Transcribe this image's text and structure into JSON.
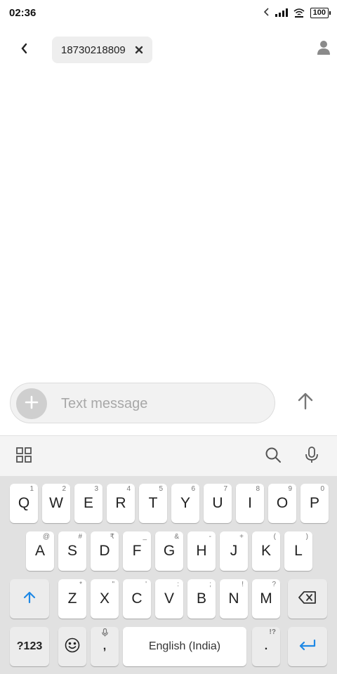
{
  "status_bar": {
    "time": "02:36",
    "battery": "100"
  },
  "header": {
    "recipient": "18730218809"
  },
  "compose": {
    "placeholder": "Text message"
  },
  "keyboard": {
    "row1": [
      {
        "label": "Q",
        "hint": "1"
      },
      {
        "label": "W",
        "hint": "2"
      },
      {
        "label": "E",
        "hint": "3"
      },
      {
        "label": "R",
        "hint": "4"
      },
      {
        "label": "T",
        "hint": "5"
      },
      {
        "label": "Y",
        "hint": "6"
      },
      {
        "label": "U",
        "hint": "7"
      },
      {
        "label": "I",
        "hint": "8"
      },
      {
        "label": "O",
        "hint": "9"
      },
      {
        "label": "P",
        "hint": "0"
      }
    ],
    "row2": [
      {
        "label": "A",
        "hint": "@"
      },
      {
        "label": "S",
        "hint": "#"
      },
      {
        "label": "D",
        "hint": "₹"
      },
      {
        "label": "F",
        "hint": "_"
      },
      {
        "label": "G",
        "hint": "&"
      },
      {
        "label": "H",
        "hint": "-"
      },
      {
        "label": "J",
        "hint": "+"
      },
      {
        "label": "K",
        "hint": "("
      },
      {
        "label": "L",
        "hint": ")"
      }
    ],
    "row3": [
      {
        "label": "Z",
        "hint": "*"
      },
      {
        "label": "X",
        "hint": "\""
      },
      {
        "label": "C",
        "hint": "'"
      },
      {
        "label": "V",
        "hint": ":"
      },
      {
        "label": "B",
        "hint": ";"
      },
      {
        "label": "N",
        "hint": "!"
      },
      {
        "label": "M",
        "hint": "?"
      }
    ],
    "sym_label": "?123",
    "comma_label": ",",
    "space_label": "English (India)",
    "period_label": ".",
    "period_hint": "!?"
  },
  "colors": {
    "accent": "#1e88e5",
    "keyboard_bg": "#e1e1e1"
  }
}
